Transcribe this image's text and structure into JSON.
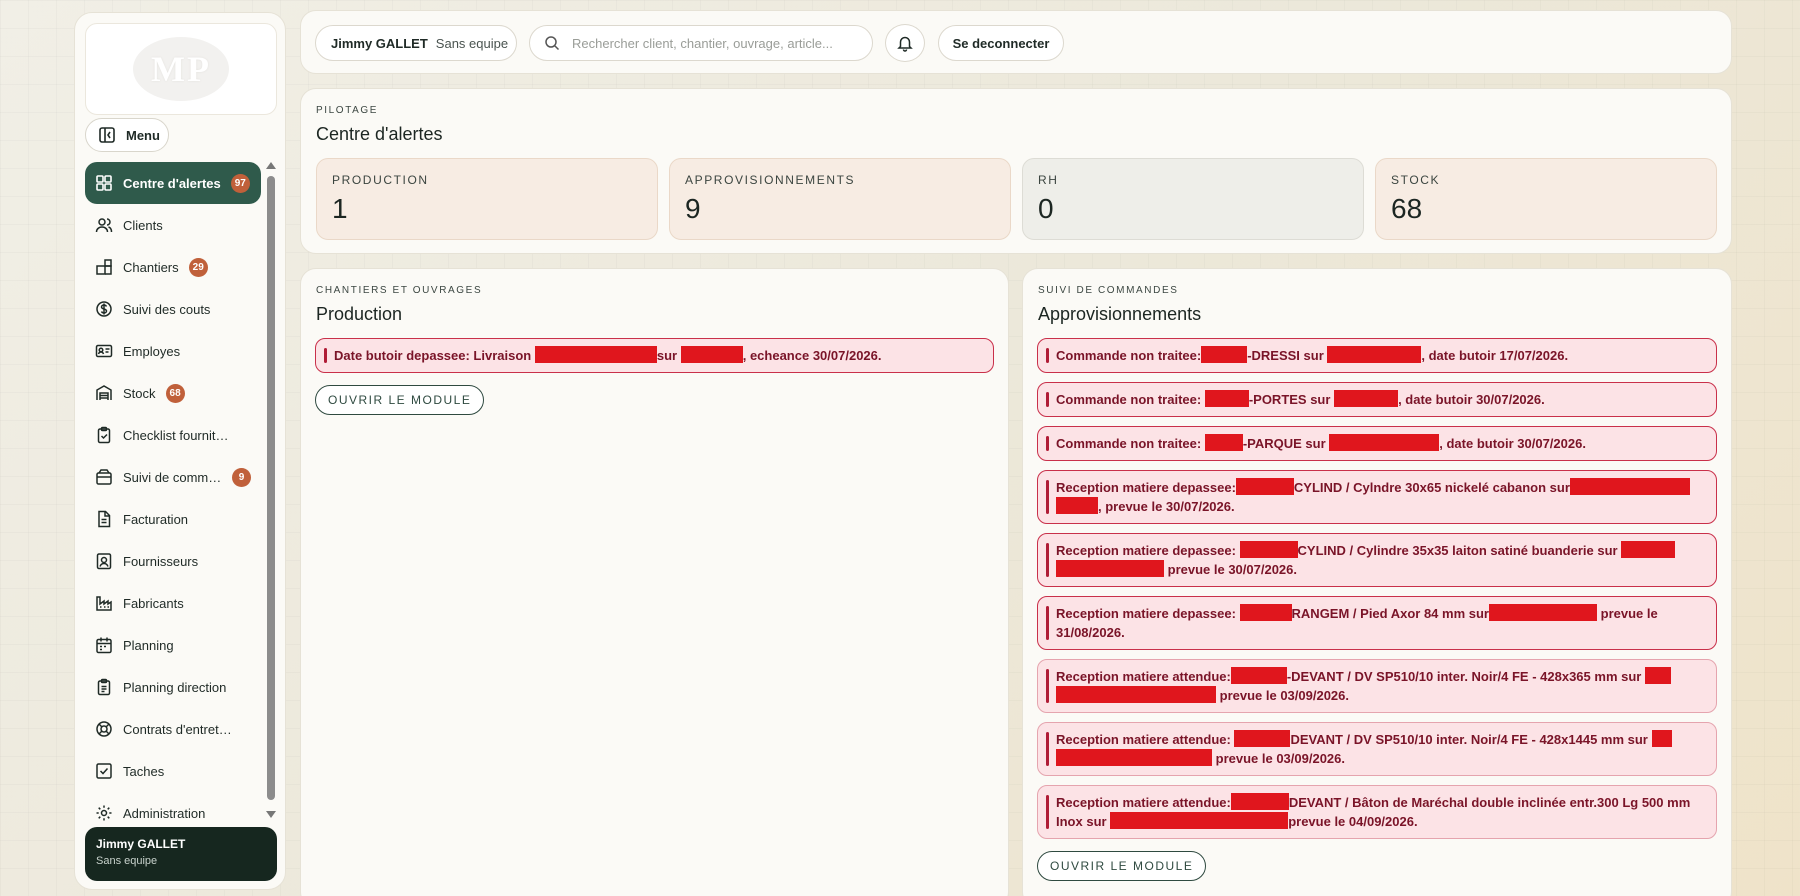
{
  "brand": {
    "logo_text": "MP"
  },
  "sidebar": {
    "menu_label": "Menu",
    "items": [
      {
        "label": "Centre d'alertes",
        "badge": "97",
        "icon": "dashboard-icon"
      },
      {
        "label": "Clients",
        "badge": "",
        "icon": "users-icon"
      },
      {
        "label": "Chantiers",
        "badge": "29",
        "icon": "blocks-icon"
      },
      {
        "label": "Suivi des couts",
        "badge": "",
        "icon": "dollar-icon"
      },
      {
        "label": "Employes",
        "badge": "",
        "icon": "id-card-icon"
      },
      {
        "label": "Stock",
        "badge": "68",
        "icon": "warehouse-icon"
      },
      {
        "label": "Checklist fournitures",
        "badge": "",
        "icon": "clipboard-check-icon"
      },
      {
        "label": "Suivi de commandes",
        "badge": "9",
        "icon": "box-icon"
      },
      {
        "label": "Facturation",
        "badge": "",
        "icon": "file-icon"
      },
      {
        "label": "Fournisseurs",
        "badge": "",
        "icon": "contact-icon"
      },
      {
        "label": "Fabricants",
        "badge": "",
        "icon": "factory-icon"
      },
      {
        "label": "Planning",
        "badge": "",
        "icon": "calendar-icon"
      },
      {
        "label": "Planning direction",
        "badge": "",
        "icon": "clipboard-list-icon"
      },
      {
        "label": "Contrats d'entretien",
        "badge": "",
        "icon": "lifebuoy-icon"
      },
      {
        "label": "Taches",
        "badge": "",
        "icon": "checkbox-icon"
      },
      {
        "label": "Administration",
        "badge": "",
        "icon": "gear-icon"
      }
    ],
    "user": {
      "name": "Jimmy GALLET",
      "team": "Sans equipe"
    }
  },
  "topbar": {
    "user_name": "Jimmy GALLET",
    "user_team": "Sans equipe",
    "search_placeholder": "Rechercher client, chantier, ouvrage, article...",
    "logout_label": "Se deconnecter"
  },
  "alerts_center": {
    "kicker": "PILOTAGE",
    "title": "Centre d'alertes",
    "stats": [
      {
        "label": "PRODUCTION",
        "value": "1"
      },
      {
        "label": "APPROVISIONNEMENTS",
        "value": "9"
      },
      {
        "label": "RH",
        "value": "0"
      },
      {
        "label": "STOCK",
        "value": "68"
      }
    ]
  },
  "production": {
    "kicker": "CHANTIERS ET OUVRAGES",
    "title": "Production",
    "alerts": [
      {
        "p1": "Date butoir depassee: Livraison",
        "p2": "sur",
        "p3": ", echeance 30/07/2026."
      }
    ],
    "open_label": "OUVRIR LE MODULE"
  },
  "supply": {
    "kicker": "SUIVI DE COMMANDES",
    "title": "Approvisionnements",
    "alerts": [
      {
        "p1": "Commande non traitee:",
        "p2": "-DRESSI sur",
        "p3": ", date butoir 17/07/2026."
      },
      {
        "p1": "Commande non traitee:",
        "p2": "-PORTES sur",
        "p3": ", date butoir 30/07/2026."
      },
      {
        "p1": "Commande non traitee:",
        "p2": "-PARQUE sur",
        "p3": ", date butoir 30/07/2026."
      },
      {
        "p1": "Reception matiere depassee:",
        "p2": "CYLIND / Cylndre 30x65 nickelé cabanon sur",
        "p3": ", prevue le 30/07/2026."
      },
      {
        "p1": "Reception matiere depassee:",
        "p2": "CYLIND / Cylindre 35x35 laiton satiné buanderie sur",
        "p3": "prevue le 30/07/2026."
      },
      {
        "p1": "Reception matiere depassee:",
        "p2": "RANGEM / Pied Axor 84 mm sur",
        "p3": "prevue le 31/08/2026."
      },
      {
        "p1": "Reception matiere attendue:",
        "p2": "-DEVANT / DV SP510/10 inter. Noir/4 FE - 428x365 mm sur",
        "p3": "prevue le 03/09/2026."
      },
      {
        "p1": "Reception matiere attendue:",
        "p2": "DEVANT / DV SP510/10 inter. Noir/4 FE - 428x1445 mm sur",
        "p3": "prevue le 03/09/2026."
      },
      {
        "p1": "Reception matiere attendue:",
        "p2": "DEVANT / Bâton de Maréchal double inclinée entr.300 Lg 500 mm Inox sur",
        "p3": "prevue le 04/09/2026."
      }
    ],
    "open_label": "OUVRIR LE MODULE"
  }
}
